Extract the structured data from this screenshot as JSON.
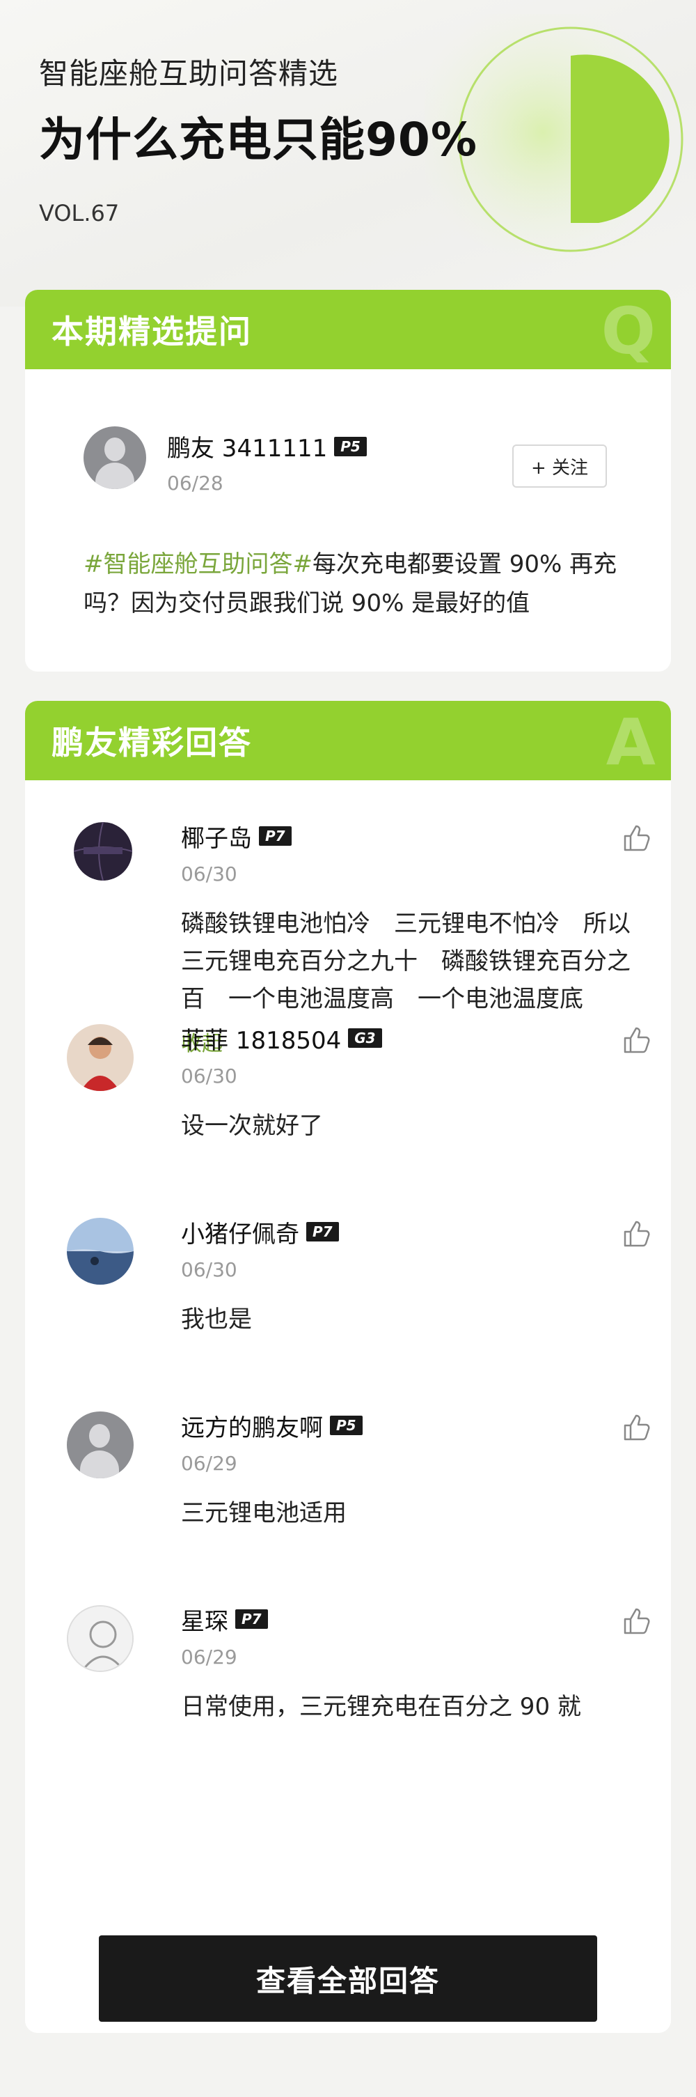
{
  "header": {
    "subtitle": "智能座舱互助问答精选",
    "title": "为什么充电只能90%",
    "vol": "VOL.67",
    "accent_color": "#93d12f"
  },
  "question_card": {
    "heading": "本期精选提问",
    "letter": "Q",
    "user": {
      "name": "鹏友 3411111",
      "badge": "P5",
      "date": "06/28"
    },
    "follow_label": "+ 关注",
    "topic": "#智能座舱互助问答#",
    "text": "每次充电都要设置 90% 再充吗？因为交付员跟我们说 90% 是最好的值"
  },
  "answers_card": {
    "heading": "鹏友精彩回答",
    "letter": "A",
    "answers": [
      {
        "name": "椰子岛",
        "badge": "P7",
        "date": "06/30",
        "text": "磷酸铁锂电池怕冷　三元锂电不怕冷　所以三元锂电充百分之九十　磷酸铁锂充百分之百　一个电池温度高　一个电池温度底",
        "collapse": "收起",
        "avatar": "basketball-avatar"
      },
      {
        "name": "菲菲 1818504",
        "badge": "G3",
        "date": "06/30",
        "text": "设一次就好了",
        "avatar": "photo-avatar-girl"
      },
      {
        "name": "小猪仔佩奇",
        "badge": "P7",
        "date": "06/30",
        "text": "我也是",
        "avatar": "photo-avatar-sea"
      },
      {
        "name": "远方的鹏友啊",
        "badge": "P5",
        "date": "06/29",
        "text": "三元锂电池适用",
        "avatar": "default-avatar"
      },
      {
        "name": "星琛",
        "badge": "P7",
        "date": "06/29",
        "text": "日常使用，三元锂充电在百分之 90 就",
        "avatar": "sketch-avatar"
      }
    ],
    "view_all_label": "查看全部回答"
  }
}
